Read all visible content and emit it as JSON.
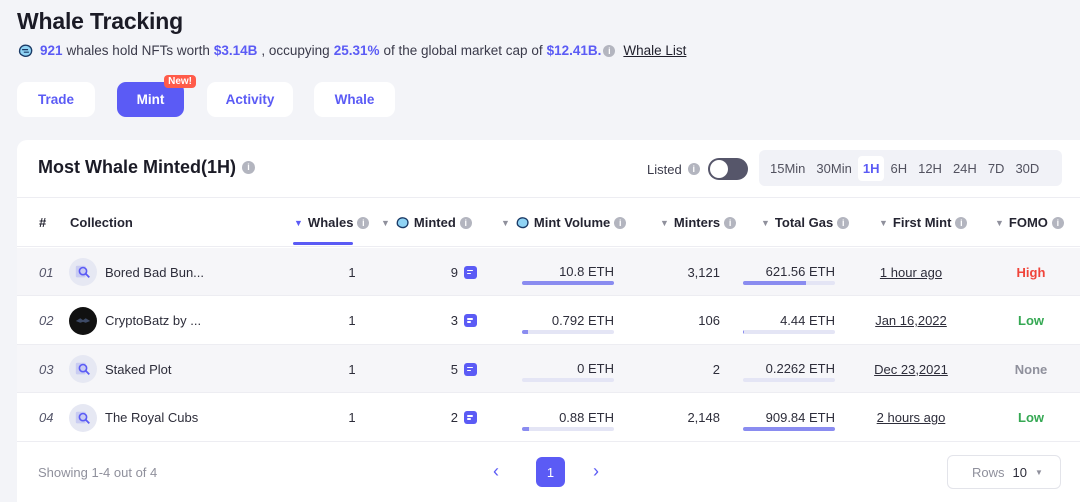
{
  "page_title": "Whale Tracking",
  "summary": {
    "whale_count": "921",
    "text1": "whales hold NFTs worth",
    "worth": "$3.14B",
    "text2": ", occupying",
    "percent": "25.31%",
    "text3": "of the global market cap of",
    "market_cap": "$12.41B.",
    "whale_list_link": "Whale List"
  },
  "tabs": [
    {
      "label": "Trade",
      "active": false
    },
    {
      "label": "Mint",
      "active": true,
      "badge": "New!"
    },
    {
      "label": "Activity",
      "active": false
    },
    {
      "label": "Whale",
      "active": false
    }
  ],
  "panel": {
    "title": "Most Whale Minted(1H)",
    "listed_label": "Listed",
    "timeframes": [
      "15Min",
      "30Min",
      "1H",
      "6H",
      "12H",
      "24H",
      "7D",
      "30D"
    ],
    "active_timeframe": "1H"
  },
  "table": {
    "headers": {
      "index": "#",
      "collection": "Collection",
      "whales": "Whales",
      "minted": "Minted",
      "mint_volume": "Mint Volume",
      "minters": "Minters",
      "total_gas": "Total Gas",
      "first_mint": "First Mint",
      "fomo": "FOMO"
    },
    "rows": [
      {
        "index": "01",
        "name": "Bored Bad Bun...",
        "whales": "1",
        "minted": "9",
        "mint_volume": "10.8 ETH",
        "mint_volume_fill": 1.0,
        "minters": "3,121",
        "total_gas": "621.56 ETH",
        "gas_fill": 0.68,
        "first_mint": "1 hour ago",
        "fomo": "High",
        "fomo_level": "high",
        "avatar": "placeholder"
      },
      {
        "index": "02",
        "name": "CryptoBatz by ...",
        "whales": "1",
        "minted": "3",
        "mint_volume": "0.792 ETH",
        "mint_volume_fill": 0.07,
        "minters": "106",
        "total_gas": "4.44 ETH",
        "gas_fill": 0.01,
        "first_mint": "Jan 16,2022",
        "fomo": "Low",
        "fomo_level": "low",
        "avatar": "dark"
      },
      {
        "index": "03",
        "name": "Staked Plot",
        "whales": "1",
        "minted": "5",
        "mint_volume": "0 ETH",
        "mint_volume_fill": 0.0,
        "minters": "2",
        "total_gas": "0.2262 ETH",
        "gas_fill": 0.0,
        "first_mint": "Dec 23,2021",
        "fomo": "None",
        "fomo_level": "none",
        "avatar": "placeholder"
      },
      {
        "index": "04",
        "name": "The Royal Cubs",
        "whales": "1",
        "minted": "2",
        "mint_volume": "0.88 ETH",
        "mint_volume_fill": 0.08,
        "minters": "2,148",
        "total_gas": "909.84 ETH",
        "gas_fill": 1.0,
        "first_mint": "2 hours ago",
        "fomo": "Low",
        "fomo_level": "low",
        "avatar": "placeholder"
      }
    ]
  },
  "footer": {
    "showing": "Showing 1-4 out of 4",
    "current_page": "1",
    "rows_label": "Rows",
    "rows_value": "10"
  },
  "colors": {
    "accent": "#5b5bf5",
    "high": "#f0443a",
    "low": "#35a853",
    "none": "#8f909c"
  }
}
